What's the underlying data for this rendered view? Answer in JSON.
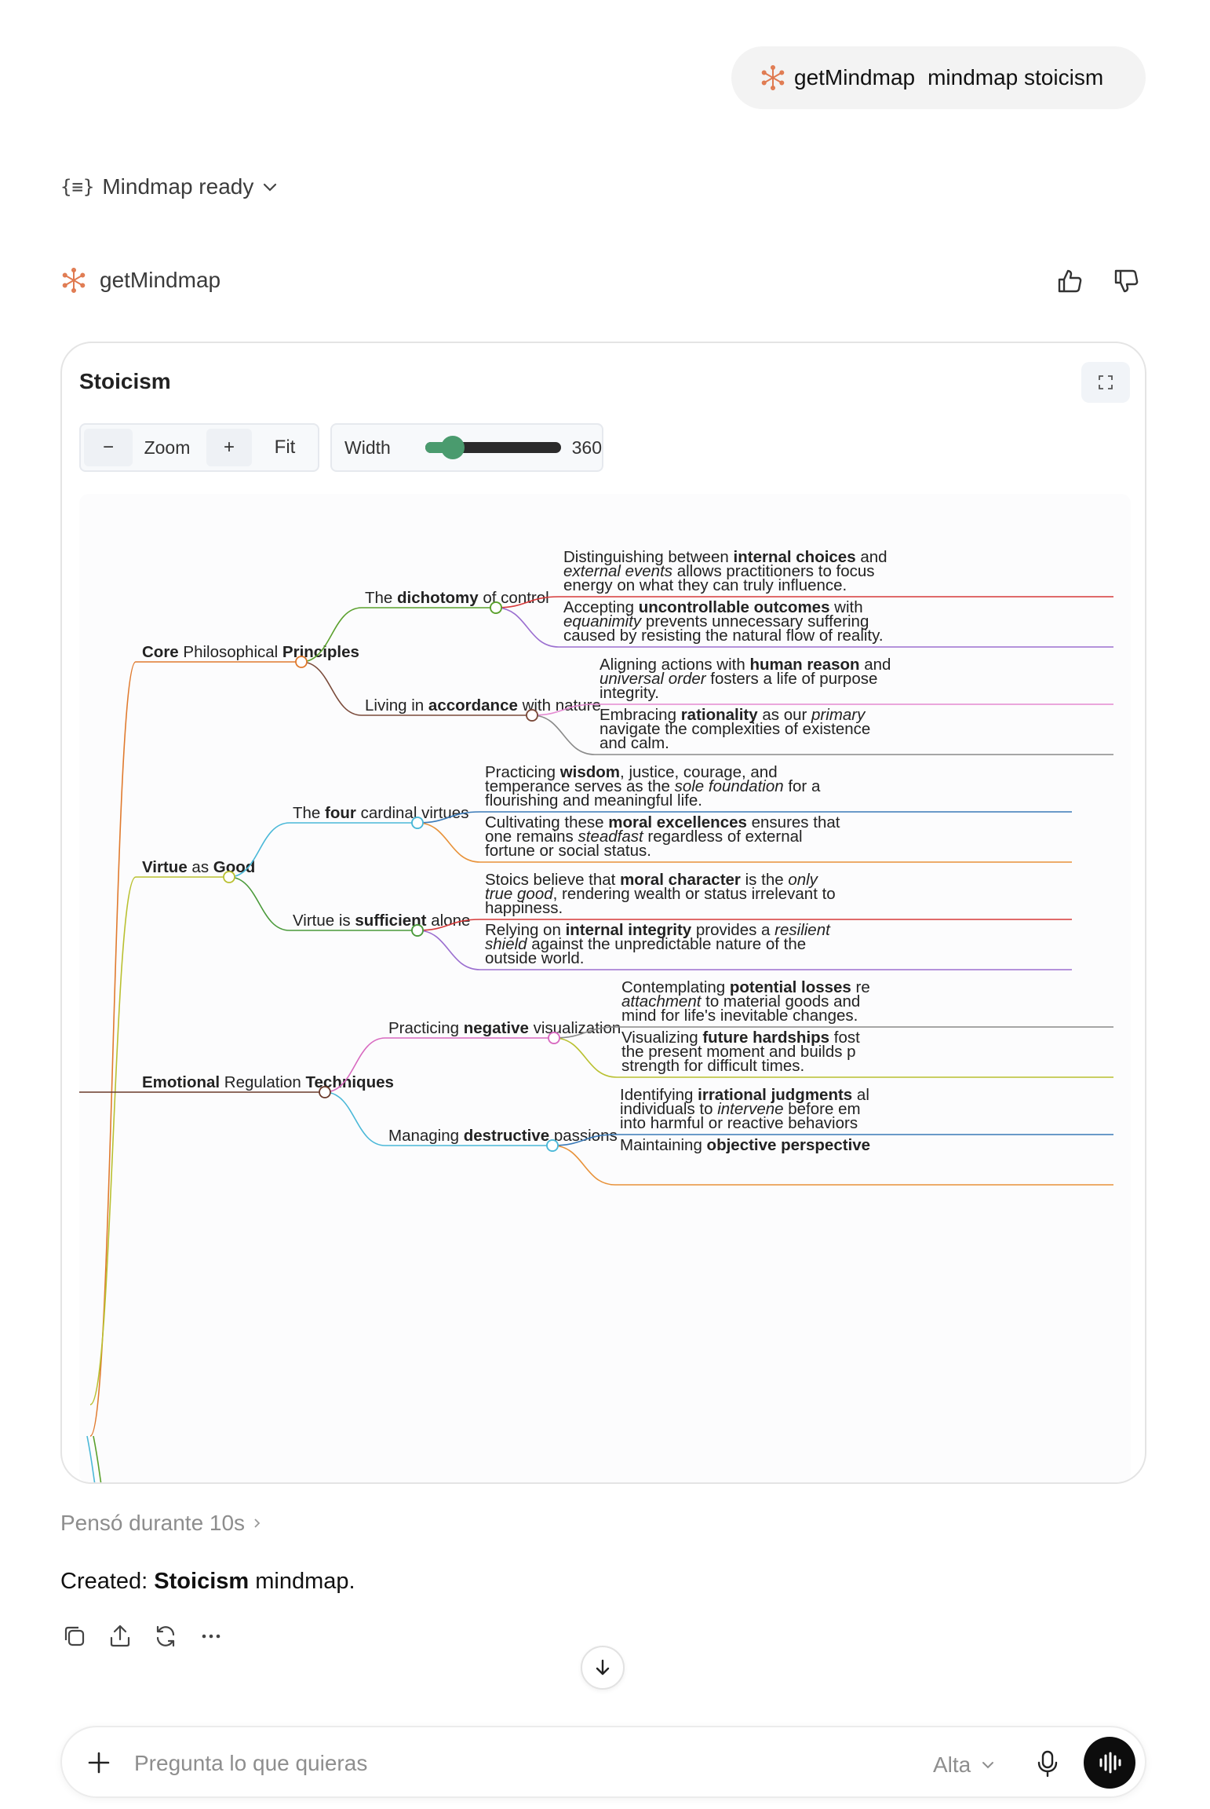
{
  "user_message": {
    "tool": "getMindmap",
    "text": "mindmap stoicism"
  },
  "status": {
    "label": "Mindmap ready"
  },
  "tool_header": {
    "name": "getMindmap"
  },
  "card": {
    "title": "Stoicism",
    "zoom": {
      "minus": "−",
      "label": "Zoom",
      "plus": "+",
      "fit": "Fit"
    },
    "width": {
      "label": "Width",
      "value": "360",
      "fraction": 0.1
    }
  },
  "mindmap": {
    "nodes": [
      {
        "runs": [
          [
            "Core",
            true
          ],
          [
            " Philosophical ",
            false
          ],
          [
            "Principles",
            true
          ]
        ],
        "color": "#e07a2e",
        "children": [
          {
            "runs": [
              [
                "The ",
                false
              ],
              [
                "dichotomy",
                true
              ],
              [
                " of control",
                false
              ]
            ],
            "color": "#5aa02c",
            "leaves": [
              {
                "color": "#d63a3a",
                "lines": [
                  [
                    [
                      "Distinguishing between ",
                      false
                    ],
                    [
                      "internal choices",
                      true
                    ],
                    [
                      " and",
                      false
                    ]
                  ],
                  [
                    [
                      "external events",
                      false,
                      true
                    ],
                    [
                      " allows practitioners to focus",
                      false
                    ]
                  ],
                  [
                    [
                      "energy on what they can truly influence.",
                      false
                    ]
                  ]
                ]
              },
              {
                "color": "#9b6fd0",
                "lines": [
                  [
                    [
                      "Accepting ",
                      false
                    ],
                    [
                      "uncontrollable outcomes",
                      true
                    ],
                    [
                      " with",
                      false
                    ]
                  ],
                  [
                    [
                      "equanimity",
                      false,
                      true
                    ],
                    [
                      " prevents unnecessary suffering",
                      false
                    ]
                  ],
                  [
                    [
                      "caused by resisting the natural flow of reality.",
                      false
                    ]
                  ]
                ]
              }
            ]
          },
          {
            "runs": [
              [
                "Living in ",
                false
              ],
              [
                "accordance",
                true
              ],
              [
                " with nature",
                false
              ]
            ],
            "color": "#7a4a3a",
            "leaves": [
              {
                "color": "#e48ad2",
                "lines": [
                  [
                    [
                      "Aligning actions with ",
                      false
                    ],
                    [
                      "human reason",
                      true
                    ],
                    [
                      " and",
                      false
                    ]
                  ],
                  [
                    [
                      "universal order",
                      false,
                      true
                    ],
                    [
                      " fosters a life of purpose",
                      false
                    ]
                  ],
                  [
                    [
                      "integrity.",
                      false
                    ]
                  ]
                ]
              },
              {
                "color": "#8a8a8a",
                "lines": [
                  [
                    [
                      "Embracing ",
                      false
                    ],
                    [
                      "rationality",
                      true
                    ],
                    [
                      " as our ",
                      false
                    ],
                    [
                      "primary",
                      false,
                      true
                    ]
                  ],
                  [
                    [
                      "navigate the complexities of existence",
                      false
                    ]
                  ],
                  [
                    [
                      "and calm.",
                      false
                    ]
                  ]
                ]
              }
            ]
          }
        ]
      },
      {
        "runs": [
          [
            "Virtue",
            true
          ],
          [
            " as ",
            false
          ],
          [
            "Good",
            true
          ]
        ],
        "color": "#b9c030",
        "children": [
          {
            "runs": [
              [
                "The ",
                false
              ],
              [
                "four",
                true
              ],
              [
                " cardinal virtues",
                false
              ]
            ],
            "color": "#4ab8d8",
            "leaves": [
              {
                "color": "#3a7ab8",
                "lines": [
                  [
                    [
                      "Practicing ",
                      false
                    ],
                    [
                      "wisdom",
                      true
                    ],
                    [
                      ", justice, courage, and",
                      false
                    ]
                  ],
                  [
                    [
                      "temperance serves as the ",
                      false
                    ],
                    [
                      "sole foundation",
                      false,
                      true
                    ],
                    [
                      " for a",
                      false
                    ]
                  ],
                  [
                    [
                      "flourishing and meaningful life.",
                      false
                    ]
                  ]
                ]
              },
              {
                "color": "#e8923a",
                "lines": [
                  [
                    [
                      "Cultivating these ",
                      false
                    ],
                    [
                      "moral excellences",
                      true
                    ],
                    [
                      " ensures that",
                      false
                    ]
                  ],
                  [
                    [
                      "one remains ",
                      false
                    ],
                    [
                      "steadfast",
                      false,
                      true
                    ],
                    [
                      " regardless of external",
                      false
                    ]
                  ],
                  [
                    [
                      "fortune or social status.",
                      false
                    ]
                  ]
                ]
              }
            ]
          },
          {
            "runs": [
              [
                "Virtue is ",
                false
              ],
              [
                "sufficient",
                true
              ],
              [
                " alone",
                false
              ]
            ],
            "color": "#4a9a3a",
            "leaves": [
              {
                "color": "#d63a3a",
                "lines": [
                  [
                    [
                      "Stoics believe that ",
                      false
                    ],
                    [
                      "moral character",
                      true
                    ],
                    [
                      " is the ",
                      false
                    ],
                    [
                      "only",
                      false,
                      true
                    ]
                  ],
                  [
                    [
                      "true good",
                      false,
                      true
                    ],
                    [
                      ", rendering wealth or status irrelevant to",
                      false
                    ]
                  ],
                  [
                    [
                      "happiness.",
                      false
                    ]
                  ]
                ]
              },
              {
                "color": "#9b6fd0",
                "lines": [
                  [
                    [
                      "Relying on ",
                      false
                    ],
                    [
                      "internal integrity",
                      true
                    ],
                    [
                      " provides a ",
                      false
                    ],
                    [
                      "resilient",
                      false,
                      true
                    ]
                  ],
                  [
                    [
                      "shield",
                      false,
                      true
                    ],
                    [
                      " against the unpredictable nature of the",
                      false
                    ]
                  ],
                  [
                    [
                      "outside world.",
                      false
                    ]
                  ]
                ]
              }
            ]
          }
        ]
      },
      {
        "runs": [
          [
            "Emotional",
            true
          ],
          [
            " Regulation ",
            false
          ],
          [
            "Techniques",
            true
          ]
        ],
        "color": "#6a3a2a",
        "children": [
          {
            "runs": [
              [
                "Practicing ",
                false
              ],
              [
                "negative",
                true
              ],
              [
                " visualization",
                false
              ]
            ],
            "color": "#d86ac0",
            "leaves": [
              {
                "color": "#8a8a8a",
                "lines": [
                  [
                    [
                      "Contemplating ",
                      false
                    ],
                    [
                      "potential losses",
                      true
                    ],
                    [
                      " re",
                      false
                    ]
                  ],
                  [
                    [
                      "attachment",
                      false,
                      true
                    ],
                    [
                      " to material goods and",
                      false
                    ]
                  ],
                  [
                    [
                      "mind for life's inevitable changes.",
                      false
                    ]
                  ]
                ]
              },
              {
                "color": "#b9c030",
                "lines": [
                  [
                    [
                      "Visualizing ",
                      false
                    ],
                    [
                      "future hardships",
                      true
                    ],
                    [
                      " fost",
                      false
                    ]
                  ],
                  [
                    [
                      "the present moment and builds p",
                      false
                    ]
                  ],
                  [
                    [
                      "strength for difficult times.",
                      false
                    ]
                  ]
                ]
              }
            ]
          },
          {
            "runs": [
              [
                "Managing ",
                false
              ],
              [
                "destructive",
                true
              ],
              [
                " passions",
                false
              ]
            ],
            "color": "#4ab8d8",
            "leaves": [
              {
                "color": "#3a7ab8",
                "lines": [
                  [
                    [
                      "Identifying ",
                      false
                    ],
                    [
                      "irrational judgments",
                      true
                    ],
                    [
                      " al",
                      false
                    ]
                  ],
                  [
                    [
                      "individuals to ",
                      false
                    ],
                    [
                      "intervene",
                      false,
                      true
                    ],
                    [
                      " before em",
                      false
                    ]
                  ],
                  [
                    [
                      "into harmful or reactive behaviors",
                      false
                    ]
                  ]
                ]
              },
              {
                "color": "#e8923a",
                "lines": [
                  [
                    [
                      "Maintaining ",
                      false
                    ],
                    [
                      "objective perspective",
                      true
                    ]
                  ]
                ]
              }
            ]
          }
        ]
      }
    ]
  },
  "thought": {
    "label": "Pensó durante 10s"
  },
  "answer": {
    "prefix": "Created: ",
    "bold": "Stoicism",
    "suffix": " mindmap."
  },
  "composer": {
    "placeholder": "Pregunta lo que quieras",
    "model": "Alta"
  }
}
